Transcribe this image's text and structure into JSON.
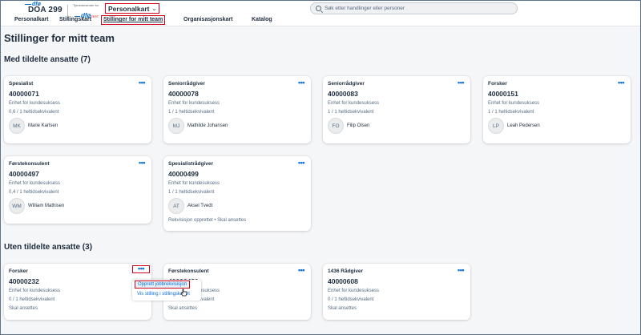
{
  "header": {
    "logo_text": "dfø",
    "app_code": "DOA 299",
    "logo2_small": "Tjenestesenter for",
    "logo2_mark": "dfø",
    "logo2_env": "TEST",
    "app_menu_label": "Personalkart",
    "search_placeholder": "Søk etter handlinger eller personer"
  },
  "nav": {
    "items": [
      "Personalkart",
      "Stillingskart",
      "Stillinger for mitt team",
      "Organisasjonskart",
      "Katalog"
    ],
    "active_index": 2
  },
  "page": {
    "title": "Stillinger for mitt team",
    "section_assigned": "Med tildelte ansatte (7)",
    "section_unassigned": "Uten tildelte ansatte (3)"
  },
  "assigned_cards": [
    {
      "role": "Spesialist",
      "number": "40000071",
      "unit": "Enhet for kundesuksess",
      "fte": "0,6 / 1 helt­idsekvivalent",
      "initials": "MK",
      "name": "Marie Karlsen",
      "status": ""
    },
    {
      "role": "Seniorrådgiver",
      "number": "40000078",
      "unit": "Enhet for kundesuksess",
      "fte": "1 / 1 heltidsekvivalent",
      "initials": "MJ",
      "name": "Mathilde Johansen",
      "status": ""
    },
    {
      "role": "Seniorrådgiver",
      "number": "40000083",
      "unit": "Enhet for kundesuksess",
      "fte": "1 / 1 heltidsekvivalent",
      "initials": "FO",
      "name": "Filip Olsen",
      "status": ""
    },
    {
      "role": "Forsker",
      "number": "40000151",
      "unit": "Enhet for kundesuksess",
      "fte": "1 / 1 heltidsekvivalent",
      "initials": "LP",
      "name": "Leah Pedersen",
      "status": ""
    },
    {
      "role": "Førstekonsulent",
      "number": "40000497",
      "unit": "Enhet for kundesuksess",
      "fte": "0,4 / 1 heltidsekvivalent",
      "initials": "WM",
      "name": "William Mathisen",
      "status": ""
    },
    {
      "role": "Spesialistrådgiver",
      "number": "40000499",
      "unit": "Enhet for kundesuksess",
      "fte": "1 / 1 heltidsekvivalent",
      "initials": "AT",
      "name": "Aksel Tvedt",
      "status": "Rekvisisjon opprettet • Skal ansettes"
    }
  ],
  "unassigned_cards": [
    {
      "role": "Forsker",
      "number": "40000232",
      "unit": "Enhet for kundesuksess",
      "fte": "0 / 1 heltidsekvivalent",
      "status": "Skal ansettes"
    },
    {
      "role": "Førstekonsulent",
      "number": "40000431",
      "unit": "Enhet for kundesuksess",
      "fte": "0 / 1 heltidsekvivalent",
      "status": "Skal ansettes"
    },
    {
      "role": "1436 Rådgiver",
      "number": "40000608",
      "unit": "Enhet for kundesuksess",
      "fte": "0 / 1 heltidsekvivalent",
      "status": "Skal ansettes"
    }
  ],
  "more_label": "•••",
  "popup": {
    "item1": "Opprett jobbrekvisisjon",
    "item2": "Vis stilling i stillingskartet"
  },
  "colors": {
    "accent": "#0a6ed1",
    "highlight": "#d0021b",
    "background": "#f5f6f7"
  }
}
